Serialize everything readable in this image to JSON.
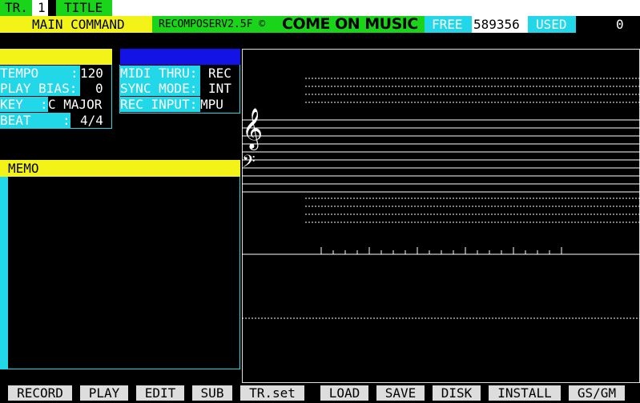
{
  "header": {
    "tr_label": "TR.",
    "tr_number": "1",
    "title_label": "TITLE",
    "title_value": "",
    "mode": "MAIN COMMAND",
    "version": "RECOMPOSERV2.5F ©",
    "brand": "COME ON MUSIC",
    "free_label": "FREE",
    "free_value": "589356",
    "used_label": "USED",
    "used_value": "0"
  },
  "settings": {
    "tempo_label": "TEMPO",
    "tempo_sep": ":",
    "tempo_value": "120",
    "play_bias_label": "PLAY BIAS:",
    "play_bias_value": "0",
    "key_label": "KEY",
    "key_sep": ":",
    "key_value": "C MAJOR",
    "beat_label": "BEAT",
    "beat_sep": ":",
    "beat_value": "4/4"
  },
  "midi": {
    "midi_thru_label": "MIDI THRU:",
    "midi_thru_value": "REC",
    "sync_mode_label": "SYNC MODE:",
    "sync_mode_value": "INT",
    "rec_input_label": "REC INPUT:",
    "rec_input_value": "MPU"
  },
  "memo": {
    "label": "MEMO",
    "content": ""
  },
  "staff": {
    "treble_clef": "𝄞",
    "bass_clef": "𝄢"
  },
  "function_keys": [
    "RECORD",
    "PLAY",
    "EDIT",
    "SUB",
    "TR.set",
    "LOAD",
    "SAVE",
    "DISK",
    "INSTALL",
    "GS/GM"
  ],
  "colors": {
    "green": "#19d419",
    "yellow": "#f3f318",
    "cyan": "#22d8e8",
    "blue": "#1313e6",
    "white": "#ffffff",
    "key_gray": "#dddddd"
  }
}
